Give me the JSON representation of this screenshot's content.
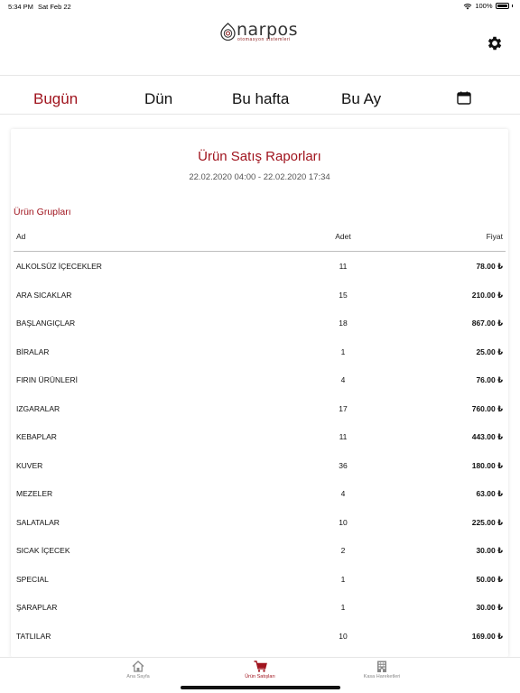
{
  "status": {
    "time": "5:34 PM",
    "date": "Sat Feb 22",
    "battery": "100%"
  },
  "logo": {
    "name": "narpos",
    "tagline": "otomasyon sistemleri"
  },
  "tabs": [
    {
      "label": "Bugün",
      "active": true
    },
    {
      "label": "Dün",
      "active": false
    },
    {
      "label": "Bu hafta",
      "active": false
    },
    {
      "label": "Bu Ay",
      "active": false
    }
  ],
  "report": {
    "title": "Ürün Satış Raporları",
    "range": "22.02.2020 04:00 - 22.02.2020 17:34",
    "section": "Ürün Grupları",
    "columns": {
      "name": "Ad",
      "qty": "Adet",
      "price": "Fiyat"
    },
    "rows": [
      {
        "name": "ALKOLSÜZ İÇECEKLER",
        "qty": "11",
        "price": "78.00 ₺"
      },
      {
        "name": "ARA SICAKLAR",
        "qty": "15",
        "price": "210.00 ₺"
      },
      {
        "name": "BAŞLANGIÇLAR",
        "qty": "18",
        "price": "867.00 ₺"
      },
      {
        "name": "BİRALAR",
        "qty": "1",
        "price": "25.00 ₺"
      },
      {
        "name": "FIRIN ÜRÜNLERİ",
        "qty": "4",
        "price": "76.00 ₺"
      },
      {
        "name": "IZGARALAR",
        "qty": "17",
        "price": "760.00 ₺"
      },
      {
        "name": "KEBAPLAR",
        "qty": "11",
        "price": "443.00 ₺"
      },
      {
        "name": "KUVER",
        "qty": "36",
        "price": "180.00 ₺"
      },
      {
        "name": "MEZELER",
        "qty": "4",
        "price": "63.00 ₺"
      },
      {
        "name": "SALATALAR",
        "qty": "10",
        "price": "225.00 ₺"
      },
      {
        "name": "SICAK İÇECEK",
        "qty": "2",
        "price": "30.00 ₺"
      },
      {
        "name": "SPECIAL",
        "qty": "1",
        "price": "50.00 ₺"
      },
      {
        "name": "ŞARAPLAR",
        "qty": "1",
        "price": "30.00 ₺"
      },
      {
        "name": "TATLILAR",
        "qty": "10",
        "price": "169.00 ₺"
      }
    ]
  },
  "nav": [
    {
      "label": "Ana Sayfa",
      "icon": "home-icon",
      "active": false
    },
    {
      "label": "Ürün Satışları",
      "icon": "cart-icon",
      "active": true
    },
    {
      "label": "Kasa Hareketleri",
      "icon": "building-icon",
      "active": false
    }
  ],
  "colors": {
    "accent": "#a0141e",
    "text": "#111111",
    "muted": "#888888"
  }
}
